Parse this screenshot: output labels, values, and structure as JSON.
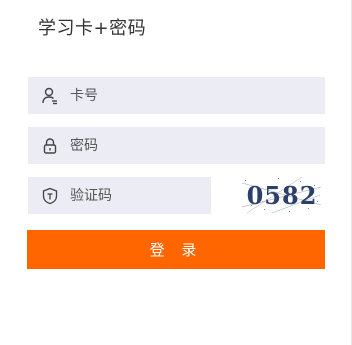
{
  "title": "学习卡+密码",
  "fields": {
    "card": {
      "placeholder": "卡号",
      "icon": "user-icon"
    },
    "password": {
      "placeholder": "密码",
      "icon": "lock-icon"
    },
    "code": {
      "placeholder": "验证码",
      "icon": "shield-icon"
    }
  },
  "captcha": {
    "text": "0582"
  },
  "login_label": "登 录",
  "colors": {
    "accent": "#ff6600",
    "field_bg": "#ececf4"
  }
}
